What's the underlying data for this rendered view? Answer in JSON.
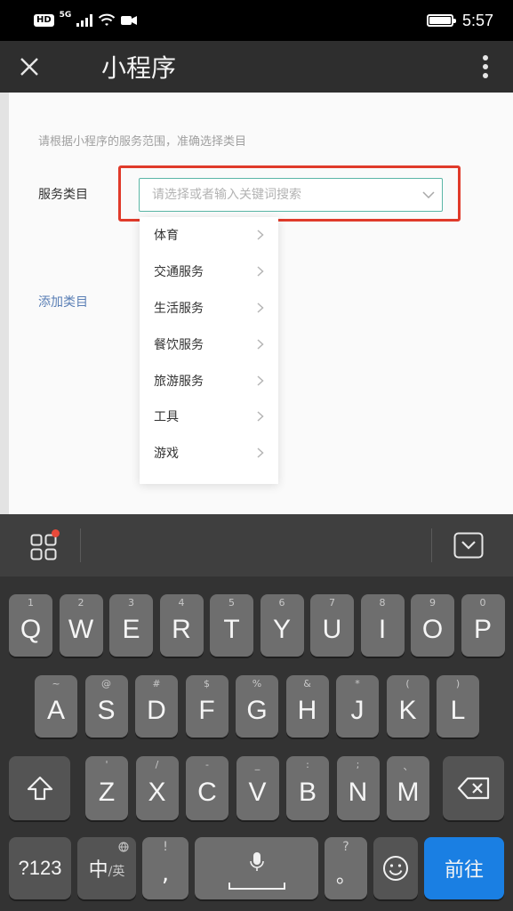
{
  "status": {
    "hd": "HD",
    "net": "5G",
    "time": "5:57"
  },
  "header": {
    "title": "小程序"
  },
  "form": {
    "hint": "请根据小程序的服务范围，准确选择类目",
    "category_label": "服务类目",
    "search_placeholder": "请选择或者输入关键词搜索",
    "add_category": "添加类目",
    "accent_color": "#5bb6a6",
    "highlight_color": "#e03a2a"
  },
  "dropdown": {
    "items": [
      "体育",
      "交通服务",
      "生活服务",
      "餐饮服务",
      "旅游服务",
      "工具",
      "游戏"
    ]
  },
  "keyboard": {
    "row1": [
      {
        "k": "Q",
        "n": "1"
      },
      {
        "k": "W",
        "n": "2"
      },
      {
        "k": "E",
        "n": "3"
      },
      {
        "k": "R",
        "n": "4"
      },
      {
        "k": "T",
        "n": "5"
      },
      {
        "k": "Y",
        "n": "6"
      },
      {
        "k": "U",
        "n": "7"
      },
      {
        "k": "I",
        "n": "8"
      },
      {
        "k": "O",
        "n": "9"
      },
      {
        "k": "P",
        "n": "0"
      }
    ],
    "row2": [
      {
        "k": "A",
        "n": "~"
      },
      {
        "k": "S",
        "n": "@"
      },
      {
        "k": "D",
        "n": "#"
      },
      {
        "k": "F",
        "n": "$"
      },
      {
        "k": "G",
        "n": "%"
      },
      {
        "k": "H",
        "n": "&"
      },
      {
        "k": "J",
        "n": "*"
      },
      {
        "k": "K",
        "n": "("
      },
      {
        "k": "L",
        "n": ")"
      }
    ],
    "row3": [
      {
        "k": "Z",
        "n": "'"
      },
      {
        "k": "X",
        "n": "/"
      },
      {
        "k": "C",
        "n": "-"
      },
      {
        "k": "V",
        "n": "_"
      },
      {
        "k": "B",
        "n": ":"
      },
      {
        "k": "N",
        "n": ";"
      },
      {
        "k": "M",
        "n": "、"
      }
    ],
    "num_key": "?123",
    "lang_main": "中",
    "lang_sub": "/英",
    "comma_hint": "!",
    "comma": ",",
    "period_hint": "?",
    "period": "。",
    "go_key": "前往"
  }
}
